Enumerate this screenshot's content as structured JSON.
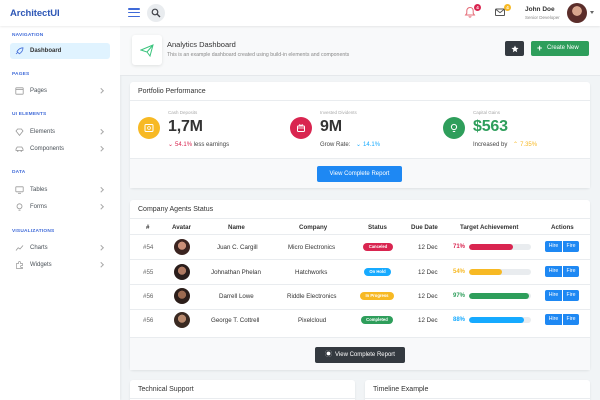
{
  "header": {
    "logo": "ArchitectUI",
    "user": {
      "name": "John Doe",
      "role": "Senior Developer"
    },
    "notifications_count": "4",
    "messages_count": "4",
    "colors": {
      "brand": "#3f6ad8",
      "notif_badge": "#d92550",
      "msg_badge": "#f7b924"
    }
  },
  "sidebar": {
    "sections": [
      {
        "heading": "NAVIGATION",
        "items": [
          {
            "label": "Dashboard",
            "icon": "rocket-icon",
            "active": true
          }
        ]
      },
      {
        "heading": "PAGES",
        "items": [
          {
            "label": "Pages",
            "icon": "browser-icon"
          }
        ]
      },
      {
        "heading": "UI ELEMENTS",
        "items": [
          {
            "label": "Elements",
            "icon": "diamond-icon"
          },
          {
            "label": "Components",
            "icon": "car-icon"
          }
        ]
      },
      {
        "heading": "DATA",
        "items": [
          {
            "label": "Tables",
            "icon": "display-icon"
          },
          {
            "label": "Forms",
            "icon": "light-icon"
          }
        ]
      },
      {
        "heading": "VISUALIZATIONS",
        "items": [
          {
            "label": "Charts",
            "icon": "graph-icon"
          },
          {
            "label": "Widgets",
            "icon": "plugin-icon"
          }
        ]
      }
    ]
  },
  "page_title": {
    "title": "Analytics Dashboard",
    "subtitle": "This is an example dashboard created using build-in elements and components",
    "create_button": "Create New"
  },
  "portfolio": {
    "title": "Portfolio Performance",
    "metrics": [
      {
        "caption": "Cash Deposits",
        "value": "1,7M",
        "change": "54.1%",
        "direction": "down",
        "note": "less earnings",
        "color": "#f7b924"
      },
      {
        "caption": "Invested Dividents",
        "value": "9M",
        "label": "Grow Rate:",
        "change": "14.1%",
        "direction": "down",
        "color": "#d92550"
      },
      {
        "caption": "Capital Gains",
        "value": "$563",
        "label": "Increased by",
        "change": "7.35%",
        "direction": "up",
        "color": "#3ac47d"
      }
    ],
    "button": "View Complete Report"
  },
  "agents": {
    "title": "Company Agents Status",
    "columns": [
      "#",
      "Avatar",
      "Name",
      "Company",
      "Status",
      "Due Date",
      "Target Achievement",
      "Actions"
    ],
    "rows": [
      {
        "id": "#54",
        "name": "Juan C. Cargill",
        "company": "Micro Electronics",
        "status": "Canceled",
        "status_color": "#d92550",
        "due": "12 Dec",
        "pct": "71%",
        "progress": 0.71,
        "bar_color": "#d92550"
      },
      {
        "id": "#55",
        "name": "Johnathan Phelan",
        "company": "Hatchworks",
        "status": "On Hold",
        "status_color": "#16aaff",
        "due": "12 Dec",
        "pct": "54%",
        "progress": 0.54,
        "bar_color": "#f7b924"
      },
      {
        "id": "#56",
        "name": "Darrell Lowe",
        "company": "Riddle Electronics",
        "status": "In Progress",
        "status_color": "#f7b924",
        "due": "12 Dec",
        "pct": "97%",
        "progress": 0.97,
        "bar_color": "#3ac47d"
      },
      {
        "id": "#56",
        "name": "George T. Cottrell",
        "company": "Pixelcloud",
        "status": "Completed",
        "status_color": "#3ac47d",
        "due": "12 Dec",
        "pct": "88%",
        "progress": 0.88,
        "bar_color": "#16aaff"
      }
    ],
    "actions": {
      "hire": "Hire",
      "fire": "Fire"
    },
    "button": "View Complete Report"
  },
  "bottom_cards": {
    "left_title": "Technical Support",
    "right_title": "Timeline Example"
  }
}
